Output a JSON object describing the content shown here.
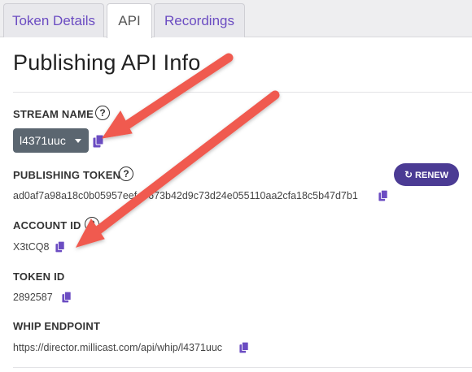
{
  "tabs": [
    {
      "label": "Token Details",
      "active": false
    },
    {
      "label": "API",
      "active": true
    },
    {
      "label": "Recordings",
      "active": false
    }
  ],
  "page_title": "Publishing API Info",
  "help_glyph": "?",
  "stream_name": {
    "label": "STREAM NAME",
    "selected": "l4371uuc"
  },
  "publishing_token": {
    "label": "PUBLISHING TOKEN",
    "value": "ad0af7a98a18c0b05957eef..7673b42d9c73d24e055110aa2cfa18c5b47d7b1",
    "renew_label": "RENEW"
  },
  "account_id": {
    "label": "ACCOUNT ID",
    "value": "X3tCQ8"
  },
  "token_id": {
    "label": "TOKEN ID",
    "value": "2892587"
  },
  "whip_endpoint": {
    "label": "WHIP ENDPOINT",
    "value": "https://director.millicast.com/api/whip/l4371uuc"
  },
  "colors": {
    "accent": "#6b4cc2",
    "renew_button": "#4b3b94",
    "dropdown": "#5b6670",
    "annotation_arrow": "#f05a4f"
  },
  "icons": {
    "copy": "copy-icon",
    "renew": "refresh-icon",
    "help": "help-circle-icon"
  }
}
